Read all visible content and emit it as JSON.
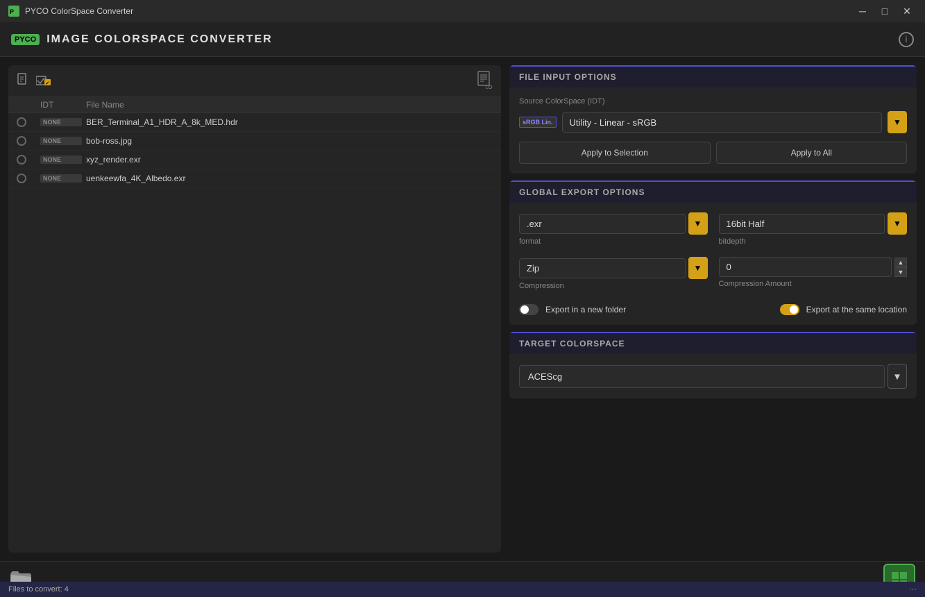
{
  "titleBar": {
    "title": "PYCO ColorSpace Converter",
    "minimize": "─",
    "maximize": "□",
    "close": "✕"
  },
  "header": {
    "logoBadge": "PYCO",
    "appTitle": "IMAGE  COLORSPACE  CONVERTER",
    "infoLabel": "i"
  },
  "filePanel": {
    "columns": {
      "idt": "IDT",
      "fileName": "File Name"
    },
    "files": [
      {
        "idt": "NONE",
        "name": "BER_Terminal_A1_HDR_A_8k_MED.hdr"
      },
      {
        "idt": "NONE",
        "name": "bob-ross.jpg"
      },
      {
        "idt": "NONE",
        "name": "xyz_render.exr"
      },
      {
        "idt": "NONE",
        "name": "uenkeewfa_4K_Albedo.exr"
      }
    ]
  },
  "fileInputOptions": {
    "sectionTitle": "File Input Options",
    "colorspaceLabel": "Source ColorSpace (IDT)",
    "csLabel": "sRGB Lin.",
    "csValue": "Utility - Linear - sRGB",
    "applySelectionLabel": "Apply to Selection",
    "applyAllLabel": "Apply to All"
  },
  "globalExportOptions": {
    "sectionTitle": "Global Export Options",
    "format": {
      "value": ".exr",
      "label": "format"
    },
    "bitdepth": {
      "value": "16bit Half",
      "label": "bitdepth"
    },
    "compression": {
      "value": "Zip",
      "label": "Compression"
    },
    "compressionAmount": {
      "value": "0",
      "label": "Compression Amount"
    },
    "newFolderLabel": "Export in a new folder",
    "sameLocationLabel": "Export at the same location"
  },
  "targetColorspace": {
    "sectionTitle": "TARGET COLORSPACE",
    "value": "ACEScg"
  },
  "bottomBar": {
    "statusText": "Files to convert: 4",
    "dotsLabel": "···"
  }
}
